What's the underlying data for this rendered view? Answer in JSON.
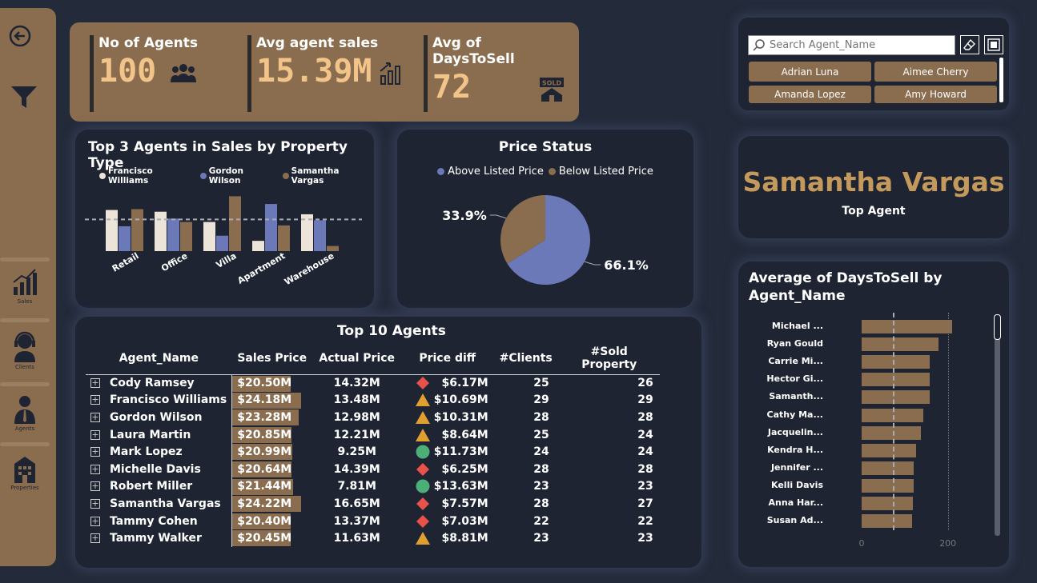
{
  "sidebar": {
    "items": [
      {
        "label": "Sales",
        "icon": "sales-chart-icon"
      },
      {
        "label": "Clients",
        "icon": "headset-icon"
      },
      {
        "label": "Agents",
        "icon": "agent-icon"
      },
      {
        "label": "Properties",
        "icon": "building-icon"
      }
    ]
  },
  "kpis": [
    {
      "title": "No of Agents",
      "value": "100",
      "icon": "people-icon"
    },
    {
      "title": "Avg agent sales",
      "value": "15.39M",
      "icon": "growth-chart-icon"
    },
    {
      "title": "Avg of DaysToSell",
      "value": "72",
      "icon": "sold-house-icon"
    }
  ],
  "slicer": {
    "placeholder": "Search Agent_Name",
    "chips": [
      "Adrian Luna",
      "Aimee Cherry",
      "Amanda Lopez",
      "Amy Howard"
    ]
  },
  "top_agent": {
    "name": "Samantha Vargas",
    "caption": "Top Agent"
  },
  "colors": {
    "cream": "#ece4d8",
    "blue": "#6b79b8",
    "brown": "#8a6d4f",
    "gold": "#c49a5c"
  },
  "chart_data": [
    {
      "type": "bar",
      "title": "Top 3 Agents in Sales by Property Type",
      "categories": [
        "Retail",
        "Office",
        "Villa",
        "Apartment",
        "Warehouse"
      ],
      "series": [
        {
          "name": "Francisco Williams",
          "values": [
            4.8,
            4.6,
            3.4,
            1.2,
            4.3
          ]
        },
        {
          "name": "Gordon Wilson",
          "values": [
            2.9,
            3.8,
            1.8,
            5.5,
            3.6
          ]
        },
        {
          "name": "Samantha Vargas",
          "values": [
            4.9,
            3.4,
            6.4,
            3.0,
            0.6
          ]
        }
      ],
      "reference_line": 3.7,
      "ylim": [
        0,
        7
      ]
    },
    {
      "type": "pie",
      "title": "Price Status",
      "slices": [
        {
          "name": "Above Listed Price",
          "value": 66.1,
          "label": "66.1%"
        },
        {
          "name": "Below Listed Price",
          "value": 33.9,
          "label": "33.9%"
        }
      ]
    },
    {
      "type": "bar",
      "orientation": "horizontal",
      "title": "Average of DaysToSell by Agent_Name",
      "categories": [
        "Michael ...",
        "Ryan Gould",
        "Carrie Mi...",
        "Hector Gi...",
        "Samanth...",
        "Cathy Ma...",
        "Jacquelin...",
        "Kendra H...",
        "Jennifer ...",
        "Kelli Davis",
        "Anna Har...",
        "Susan Ad..."
      ],
      "values": [
        210,
        178,
        158,
        158,
        158,
        143,
        138,
        127,
        121,
        120,
        119,
        117
      ],
      "reference_line": 72,
      "xlim": [
        0,
        260
      ],
      "xticks": [
        "0",
        "200"
      ]
    },
    {
      "type": "table",
      "title": "Top 10 Agents",
      "columns": [
        "Agent_Name",
        "Sales Price",
        "Actual Price",
        "Price diff",
        "#Clients",
        "#Sold Property"
      ],
      "rows": [
        {
          "name": "Cody Ramsey",
          "sales": "$20.50M",
          "sales_value": 20.5,
          "actual": "14.32M",
          "diff": "$6.17M",
          "status": "diamond",
          "clients": "25",
          "sold": "26"
        },
        {
          "name": "Francisco Williams",
          "sales": "$24.18M",
          "sales_value": 24.18,
          "actual": "13.48M",
          "diff": "$10.69M",
          "status": "triangle",
          "clients": "29",
          "sold": "29"
        },
        {
          "name": "Gordon Wilson",
          "sales": "$23.28M",
          "sales_value": 23.28,
          "actual": "12.98M",
          "diff": "$10.31M",
          "status": "triangle",
          "clients": "28",
          "sold": "28"
        },
        {
          "name": "Laura Martin",
          "sales": "$20.85M",
          "sales_value": 20.85,
          "actual": "12.21M",
          "diff": "$8.64M",
          "status": "triangle",
          "clients": "25",
          "sold": "24"
        },
        {
          "name": "Mark Lopez",
          "sales": "$20.99M",
          "sales_value": 20.99,
          "actual": "9.25M",
          "diff": "$11.73M",
          "status": "circle",
          "clients": "24",
          "sold": "24"
        },
        {
          "name": "Michelle Davis",
          "sales": "$20.64M",
          "sales_value": 20.64,
          "actual": "14.39M",
          "diff": "$6.25M",
          "status": "diamond",
          "clients": "28",
          "sold": "28"
        },
        {
          "name": "Robert Miller",
          "sales": "$21.44M",
          "sales_value": 21.44,
          "actual": "7.81M",
          "diff": "$13.63M",
          "status": "circle",
          "clients": "23",
          "sold": "23"
        },
        {
          "name": "Samantha Vargas",
          "sales": "$24.22M",
          "sales_value": 24.22,
          "actual": "16.65M",
          "diff": "$7.57M",
          "status": "diamond",
          "clients": "28",
          "sold": "27"
        },
        {
          "name": "Tammy Cohen",
          "sales": "$20.40M",
          "sales_value": 20.4,
          "actual": "13.37M",
          "diff": "$7.03M",
          "status": "diamond",
          "clients": "22",
          "sold": "22"
        },
        {
          "name": "Tammy Walker",
          "sales": "$20.45M",
          "sales_value": 20.45,
          "actual": "11.63M",
          "diff": "$8.81M",
          "status": "triangle",
          "clients": "23",
          "sold": "23"
        }
      ]
    }
  ]
}
